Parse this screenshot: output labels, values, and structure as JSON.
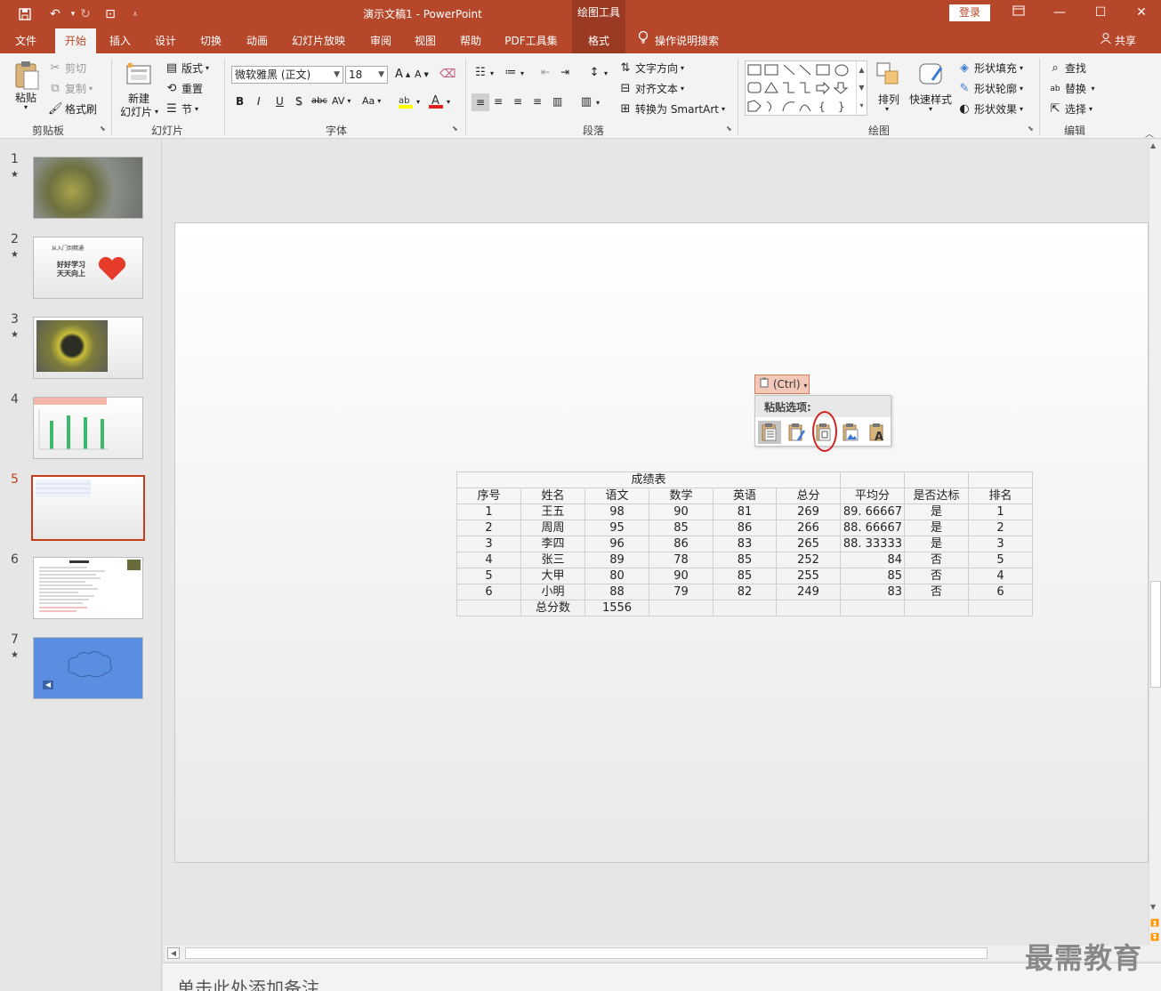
{
  "titlebar": {
    "title": "演示文稿1  -  PowerPoint",
    "drawing_tools": "绘图工具",
    "login": "登录",
    "icons": [
      "save-icon",
      "undo-icon",
      "redo-icon",
      "start-from-beginning-icon",
      "customize-qat-icon"
    ]
  },
  "tabs": [
    {
      "label": "文件"
    },
    {
      "label": "开始"
    },
    {
      "label": "插入"
    },
    {
      "label": "设计"
    },
    {
      "label": "切换"
    },
    {
      "label": "动画"
    },
    {
      "label": "幻灯片放映"
    },
    {
      "label": "审阅"
    },
    {
      "label": "视图"
    },
    {
      "label": "帮助"
    },
    {
      "label": "PDF工具集"
    },
    {
      "label": "格式"
    }
  ],
  "tell_me": "操作说明搜索",
  "share": "共享",
  "ribbon": {
    "clipboard": {
      "paste": "粘贴",
      "cut": "剪切",
      "copy": "复制",
      "format_painter": "格式刷",
      "label": "剪贴板"
    },
    "slides": {
      "new_slide_1": "新建",
      "new_slide_2": "幻灯片",
      "layout": "版式",
      "reset": "重置",
      "section": "节",
      "label": "幻灯片"
    },
    "font": {
      "font_name": "微软雅黑 (正文)",
      "font_size": "18",
      "label": "字体",
      "bold": "B",
      "italic": "I",
      "underline": "U",
      "shadow": "S",
      "strike": "abc",
      "spacing": "AV",
      "case": "Aa",
      "color": "A"
    },
    "paragraph": {
      "text_direction": "文字方向",
      "align_text": "对齐文本",
      "smartart": "转换为 SmartArt",
      "label": "段落"
    },
    "drawing": {
      "arrange": "排列",
      "quick_styles": "快速样式",
      "shape_fill": "形状填充",
      "shape_outline": "形状轮廓",
      "shape_effects": "形状效果",
      "label": "绘图"
    },
    "editing": {
      "find": "查找",
      "replace": "替换",
      "select": "选择",
      "label": "编辑"
    }
  },
  "slides": [
    {
      "num": "1",
      "star": "★"
    },
    {
      "num": "2",
      "star": "★",
      "line1": "从入门到精通",
      "line2": "好好学习",
      "line3": "天天向上"
    },
    {
      "num": "3",
      "star": "★"
    },
    {
      "num": "4"
    },
    {
      "num": "5"
    },
    {
      "num": "6"
    },
    {
      "num": "7",
      "star": "★"
    }
  ],
  "selected_slide": 5,
  "paste_popup": {
    "ctrl_label": "(Ctrl)",
    "header": "粘贴选项:",
    "options": [
      "use-destination-styles-icon",
      "keep-source-formatting-icon",
      "embed-icon",
      "picture-icon",
      "keep-text-only-icon"
    ]
  },
  "table": {
    "title": "成绩表",
    "headers": [
      "序号",
      "姓名",
      "语文",
      "数学",
      "英语",
      "总分",
      "平均分",
      "是否达标",
      "排名"
    ],
    "rows": [
      [
        "1",
        "王五",
        "98",
        "90",
        "81",
        "269",
        "89. 66667",
        "是",
        "1"
      ],
      [
        "2",
        "周周",
        "95",
        "85",
        "86",
        "266",
        "88. 66667",
        "是",
        "2"
      ],
      [
        "3",
        "李四",
        "96",
        "86",
        "83",
        "265",
        "88. 33333",
        "是",
        "3"
      ],
      [
        "4",
        "张三",
        "89",
        "78",
        "85",
        "252",
        "84",
        "否",
        "5"
      ],
      [
        "5",
        "大甲",
        "80",
        "90",
        "85",
        "255",
        "85",
        "否",
        "4"
      ],
      [
        "6",
        "小明",
        "88",
        "79",
        "82",
        "249",
        "83",
        "否",
        "6"
      ]
    ],
    "total_label": "总分数",
    "total_value": "1556"
  },
  "notes_placeholder": "单击此处添加备注",
  "watermark": "最需教育",
  "colors": {
    "accent": "#b7472a",
    "accent_dark": "#9a3a22",
    "ribbon_bg": "#f3f3f3",
    "selected_thumb": "#c43e1c",
    "highlight_circle": "#d42020"
  }
}
